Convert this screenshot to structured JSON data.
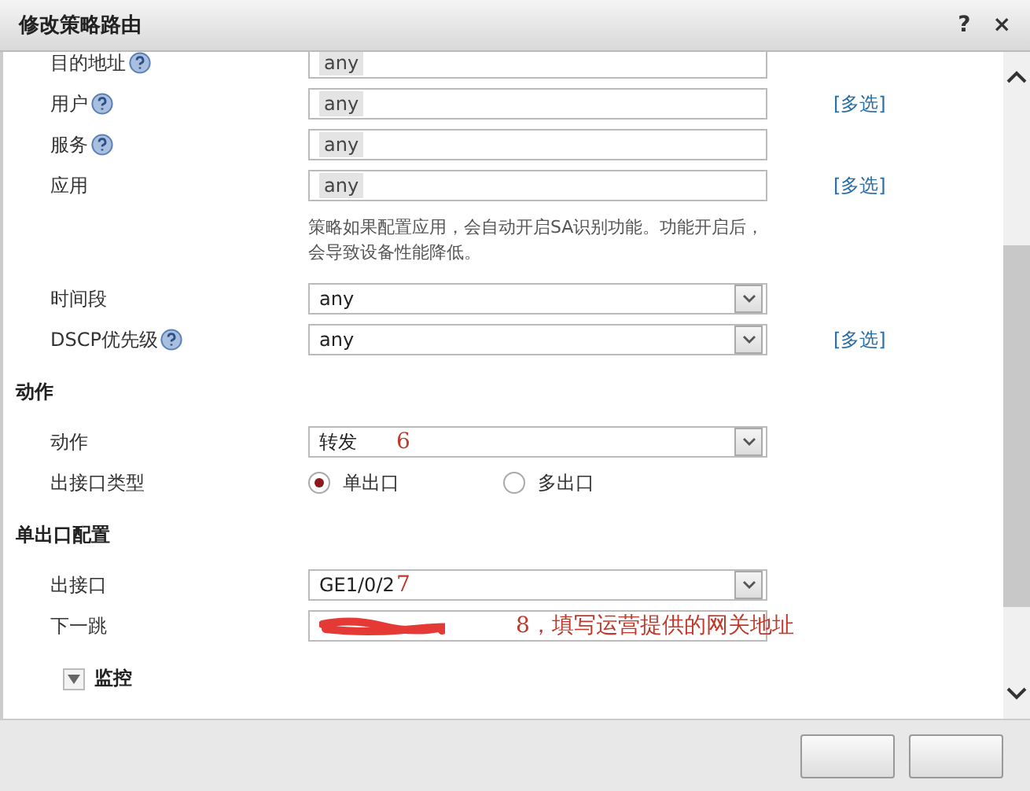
{
  "window": {
    "title": "修改策略路由",
    "help": "?",
    "close": "×"
  },
  "sections": [
    {
      "rows": [
        {
          "kind": "tags",
          "label": "目的地址",
          "help": true,
          "tags": [
            "any"
          ]
        },
        {
          "kind": "tags",
          "label": "用户",
          "help": true,
          "tags": [
            "any"
          ],
          "link": "[多选]"
        },
        {
          "kind": "tags",
          "label": "服务",
          "help": true,
          "tags": [
            "any"
          ]
        },
        {
          "kind": "tags",
          "label": "应用",
          "help": false,
          "tags": [
            "any"
          ],
          "link": "[多选]"
        },
        {
          "kind": "note",
          "text": "策略如果配置应用，会自动开启SA识别功能。功能开启后，会导致设备性能降低。"
        },
        {
          "kind": "select",
          "label": "时间段",
          "help": false,
          "value": "any"
        },
        {
          "kind": "select",
          "label": "DSCP优先级",
          "help": true,
          "value": "any",
          "link": "[多选]"
        }
      ]
    },
    {
      "heading": "动作",
      "rows": [
        {
          "kind": "select",
          "label": "动作",
          "help": false,
          "value": "转发",
          "annotation": "6"
        },
        {
          "kind": "radio",
          "label": "出接口类型",
          "help": false,
          "options": [
            {
              "label": "单出口",
              "selected": true
            },
            {
              "label": "多出口",
              "selected": false
            }
          ]
        }
      ]
    },
    {
      "heading": "单出口配置",
      "rows": [
        {
          "kind": "select",
          "label": "出接口",
          "help": false,
          "value": "GE1/0/2",
          "annotation": "7"
        },
        {
          "kind": "redacted",
          "label": "下一跳",
          "help": false,
          "annotation": "8，填写运营提供的网关地址"
        }
      ]
    }
  ],
  "collapsible": {
    "label": "监控",
    "expanded": false
  }
}
